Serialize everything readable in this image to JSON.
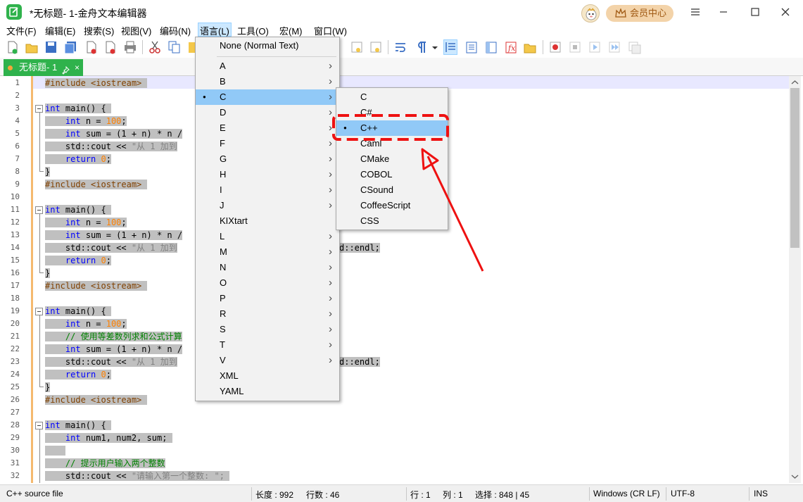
{
  "window": {
    "title": "*无标题- 1-金舟文本编辑器",
    "vip_label": "会员中心"
  },
  "menubar": [
    "文件(F)",
    "编辑(E)",
    "搜索(S)",
    "视图(V)",
    "编码(N)",
    "语言(L)",
    "工具(O)",
    "宏(M)",
    "窗口(W)"
  ],
  "tab": {
    "label": "无标题- 1",
    "close": "×"
  },
  "editor": {
    "line_numbers": [
      "1",
      "2",
      "3",
      "4",
      "5",
      "6",
      "7",
      "8",
      "9",
      "10",
      "11",
      "12",
      "13",
      "14",
      "15",
      "16",
      "17",
      "18",
      "19",
      "20",
      "21",
      "22",
      "23",
      "24",
      "25",
      "26",
      "27",
      "28",
      "29",
      "30",
      "31",
      "32"
    ],
    "tokens": {
      "include": "#include <iostream>",
      "int_main": "int main() {",
      "int": "int",
      "main_rest": " main() {",
      "n_decl": " n = ",
      "hundred": "100",
      "semi": ";",
      "sum_decl": " sum = ",
      "expr": "(1 + n) * n /",
      "cout": "std::cout << ",
      "cout_str": "\"从 1 加到",
      "endl_tail": "d::endl;",
      "return": "return",
      "zero": "0",
      "brace_close": "}",
      "comment_formula": "// 使用等差数列求和公式计算",
      "nums_decl": " num1, num2, sum;",
      "comment_input": "// 提示用户输入两个整数",
      "cout_prompt": "\"请输入第一个整数: \";"
    }
  },
  "language_menu": {
    "none_item": "None (Normal Text)",
    "letters": [
      "A",
      "B",
      "C",
      "D",
      "E",
      "F",
      "G",
      "H",
      "I",
      "J",
      "KIXtart",
      "L",
      "M",
      "N",
      "O",
      "P",
      "R",
      "S",
      "T",
      "V",
      "XML",
      "YAML"
    ],
    "selected": "C"
  },
  "c_submenu": {
    "items": [
      "C",
      "C#",
      "C++",
      "Caml",
      "CMake",
      "COBOL",
      "CSound",
      "CoffeeScript",
      "CSS"
    ],
    "selected": "C++"
  },
  "statusbar": {
    "file_type": "C++ source file",
    "length": "长度 : 992",
    "lines": "行数 : 46",
    "row": "行 : 1",
    "col": "列 : 1",
    "selection": "选择 : 848 | 45",
    "eol": "Windows (CR LF)",
    "encoding": "UTF-8",
    "mode": "INS"
  },
  "colors": {
    "brand": "#2fb24c",
    "highlight": "#91c9f7",
    "annotation": "#ee1111",
    "keyword": "#0000ff",
    "number": "#ff8000",
    "comment": "#008000"
  }
}
